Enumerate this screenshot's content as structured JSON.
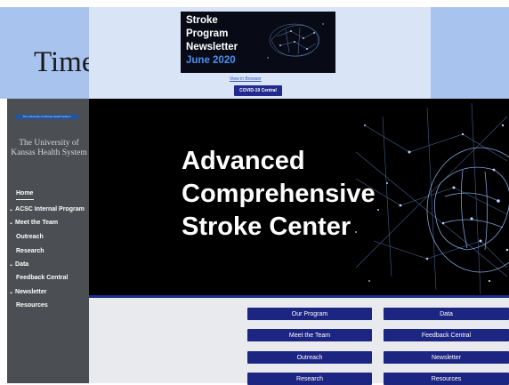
{
  "newsletter": {
    "partial_heading": "Time",
    "card_title_lines": [
      "Stroke",
      "Program",
      "Newsletter"
    ],
    "card_date": "June 2020",
    "view_in_browser": "View in Browser",
    "covid_button": "COVID-19 Central"
  },
  "sidebar": {
    "logo_text": "The University of Kansas Health System",
    "org_name": "The University of Kansas Health System",
    "nav": [
      {
        "label": "Home",
        "type": "active"
      },
      {
        "label": "ACSC Internal Program",
        "type": "expandable"
      },
      {
        "label": "Meet the Team",
        "type": "expandable"
      },
      {
        "label": "Outreach",
        "type": "link"
      },
      {
        "label": "Research",
        "type": "link"
      },
      {
        "label": "Data",
        "type": "expandable"
      },
      {
        "label": "Feedback Central",
        "type": "link"
      },
      {
        "label": "Newsletter",
        "type": "expandable"
      },
      {
        "label": "Resources",
        "type": "link"
      }
    ]
  },
  "hero": {
    "title_lines": [
      "Advanced",
      "Comprehensive",
      "Stroke Center"
    ]
  },
  "quick_links": {
    "left": [
      "Our Program",
      "Meet the Team",
      "Outreach",
      "Research"
    ],
    "right": [
      "Data",
      "Feedback Central",
      "Newsletter",
      "Resources"
    ]
  },
  "colors": {
    "accent_blue": "#1d2582",
    "sidebar_bg": "#4b4e53",
    "light_blue": "#a9c3ef",
    "date_blue": "#4b8ff0"
  }
}
